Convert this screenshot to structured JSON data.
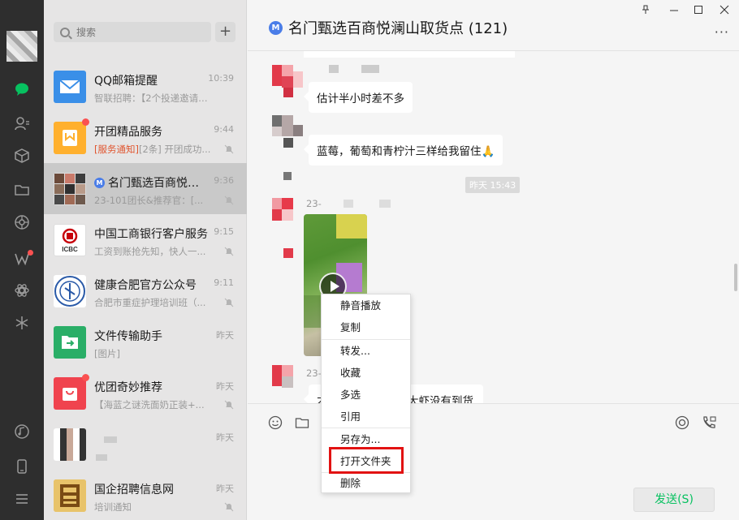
{
  "search": {
    "placeholder": "搜索"
  },
  "conversations": [
    {
      "name": "QQ邮箱提醒",
      "time": "10:39",
      "preview": "智联招聘：【2个投递邀请】...",
      "avatar_color": "#3a8fe8"
    },
    {
      "name": "开团精品服务",
      "time": "9:44",
      "preview_tag": "[服务通知]",
      "preview": "[2条] 开团成功...",
      "avatar_color": "#ffb02e"
    },
    {
      "name": "名门甄选百商悦澜...",
      "time": "9:36",
      "preview": "23-101团长&推荐官：[...",
      "selected": true
    },
    {
      "name": "中国工商银行客户服务",
      "time": "9:15",
      "preview": "工资到账抢先知，快人一...",
      "avatar_color": "#ffffff"
    },
    {
      "name": "健康合肥官方公众号",
      "time": "9:11",
      "preview": "合肥市重症护理培训班（...",
      "avatar_color": "#ffffff"
    },
    {
      "name": "文件传输助手",
      "time": "昨天",
      "preview": "[图片]",
      "avatar_color": "#2aae67"
    },
    {
      "name": "优团奇妙推荐",
      "time": "昨天",
      "preview": "【海蓝之谜洗面奶正装+...",
      "avatar_color": "#f0434e"
    },
    {
      "name": "",
      "time": "昨天",
      "preview": "",
      "avatar_color": "#ffffff"
    },
    {
      "name": "国企招聘信息网",
      "time": "昨天",
      "preview": "培训通知",
      "avatar_color": "#e8c36a"
    }
  ],
  "icbc_label": "ICBC",
  "chat": {
    "title": "名门甄选百商悦澜山取货点 (121)",
    "badge": "M",
    "more": "···",
    "messages": [
      {
        "text": "估计半小时差不多"
      },
      {
        "text": "蓝莓，葡萄和青柠汁三样给我留住🙏"
      },
      {
        "text": "大虾没有到货"
      }
    ],
    "timestamp": "昨天 15:43",
    "sender_prefix": "23-",
    "msg_prefix": "才",
    "send_button": "发送(S)"
  },
  "context_menu": {
    "items": [
      "静音播放",
      "复制",
      "转发...",
      "收藏",
      "多选",
      "引用",
      "另存为...",
      "打开文件夹",
      "删除"
    ],
    "highlighted": "打开文件夹",
    "highlight_color": "#e21212"
  },
  "colors": {
    "rail": "#2e2e2e",
    "list": "#e6e5e5",
    "chat": "#f5f5f5",
    "accent": "#07c160"
  }
}
